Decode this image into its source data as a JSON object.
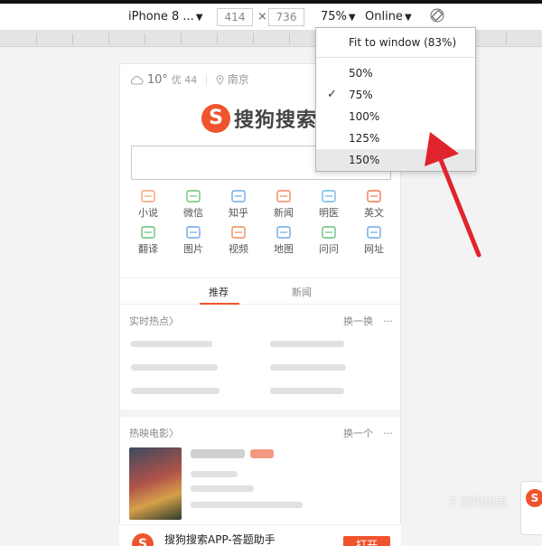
{
  "devtools": {
    "device_label": "iPhone 8 ...",
    "width_value": "414",
    "times": "×",
    "height_value": "736",
    "zoom_label": "75%",
    "network_label": "Online"
  },
  "zoom_menu": {
    "fit_label": "Fit to window (83%)",
    "options": [
      "50%",
      "75%",
      "100%",
      "125%",
      "150%"
    ],
    "checked_index": 1,
    "hovered_index": 4,
    "check_glyph": "✓"
  },
  "page": {
    "temperature": "10°",
    "aqi": "优 44",
    "location": "南京",
    "logo_letter": "S",
    "logo_text": "搜狗搜索",
    "grid_items": [
      {
        "label": "小说",
        "icon": "book-icon",
        "color": "#f4a271"
      },
      {
        "label": "微信",
        "icon": "wechat-icon",
        "color": "#6cc27a"
      },
      {
        "label": "知乎",
        "icon": "zhihu-icon",
        "color": "#6fa8e6"
      },
      {
        "label": "新闻",
        "icon": "news-icon",
        "color": "#f08a5d"
      },
      {
        "label": "明医",
        "icon": "medical-icon",
        "color": "#6fb9e6"
      },
      {
        "label": "英文",
        "icon": "english-icon",
        "color": "#f07a4f"
      },
      {
        "label": "翻译",
        "icon": "translate-icon",
        "color": "#65c17a"
      },
      {
        "label": "图片",
        "icon": "image-icon",
        "color": "#6fa8e6"
      },
      {
        "label": "视频",
        "icon": "video-icon",
        "color": "#f08a5d"
      },
      {
        "label": "地图",
        "icon": "map-icon",
        "color": "#6fa8e6"
      },
      {
        "label": "问问",
        "icon": "question-icon",
        "color": "#65c17a"
      },
      {
        "label": "网址",
        "icon": "website-icon",
        "color": "#6fa8e6"
      }
    ],
    "tabs": [
      "推荐",
      "新闻"
    ],
    "hot_title": "实时热点",
    "hot_refresh": "换一换",
    "more_glyph": "···",
    "movies_title": "热映电影",
    "movies_refresh": "换一个",
    "app_banner_text": "搜狗搜索APP-答题助手",
    "open_label": "打开",
    "chevron_glyph": "〉"
  },
  "watermark": "S 搜狗指南",
  "colors": {
    "brand": "#f0542d",
    "arrow": "#e0242d"
  }
}
